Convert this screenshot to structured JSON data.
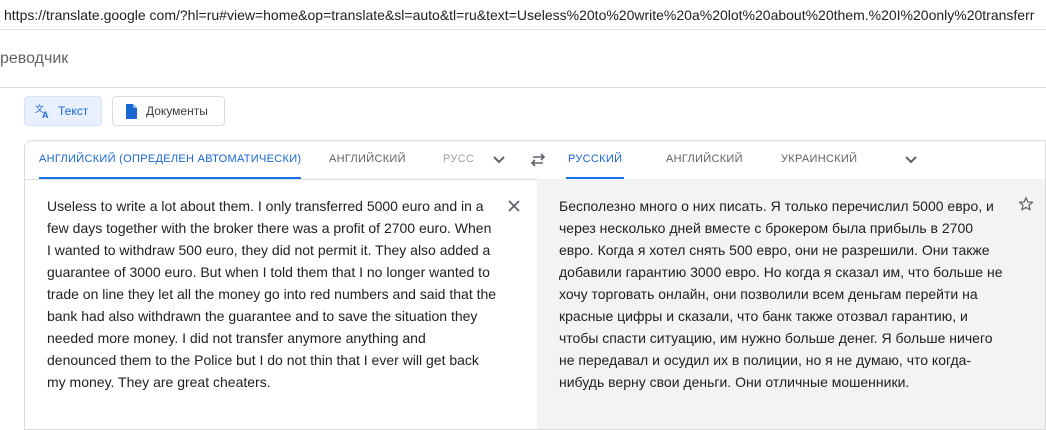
{
  "browser": {
    "url": "https://translate.google com/?hl=ru#view=home&op=translate&sl=auto&tl=ru&text=Useless%20to%20write%20a%20lot%20about%20them.%20I%20only%20transferr"
  },
  "app": {
    "title": "реводчик"
  },
  "modes": [
    {
      "label": "Текст",
      "icon": "translate-icon",
      "active": true
    },
    {
      "label": "Документы",
      "icon": "document-icon",
      "active": false
    }
  ],
  "source_languages": [
    {
      "label": "АНГЛИЙСКИЙ (ОПРЕДЕЛЕН АВТОМАТИЧЕСКИ)",
      "active": true
    },
    {
      "label": "АНГЛИЙСКИЙ",
      "active": false
    },
    {
      "label": "РУСС",
      "active": false
    }
  ],
  "target_languages": [
    {
      "label": "РУССКИЙ",
      "active": true
    },
    {
      "label": "АНГЛИЙСКИЙ",
      "active": false
    },
    {
      "label": "УКРАИНСКИЙ",
      "active": false
    }
  ],
  "source_text": "Useless to write a lot about them. I only transferred 5000 euro and in a few days together with the broker there was a profit of 2700 euro. When I wanted to withdraw 500 euro, they did not permit it. They also added a guarantee of 3000 euro. But when I told them that I no longer wanted to trade on line they let all the money go into red numbers and said that the bank had also withdrawn the guarantee and to save the situation they needed more money. I did not transfer anymore anything and denounced them to the Police but I do not thin that I ever will get back my money. They are great cheaters.",
  "translated_text": "Бесполезно много о них писать. Я только перечислил 5000 евро, и через несколько дней вместе с брокером была прибыль в 2700 евро. Когда я хотел снять 500 евро, они не разрешили. Они также добавили гарантию 3000 евро. Но когда я сказал им, что больше не хочу торговать онлайн, они позволили всем деньгам перейти на красные цифры и сказали, что банк также отозвал гарантию, и чтобы спасти ситуацию, им нужно больше денег. Я больше ничего не передавал и осудил их в полиции, но я не думаю, что когда-нибудь верну свои деньги. Они отличные мошенники.",
  "colors": {
    "accent": "#1a73e8",
    "target_bg": "#f1f3f4",
    "border": "#dadce0"
  }
}
